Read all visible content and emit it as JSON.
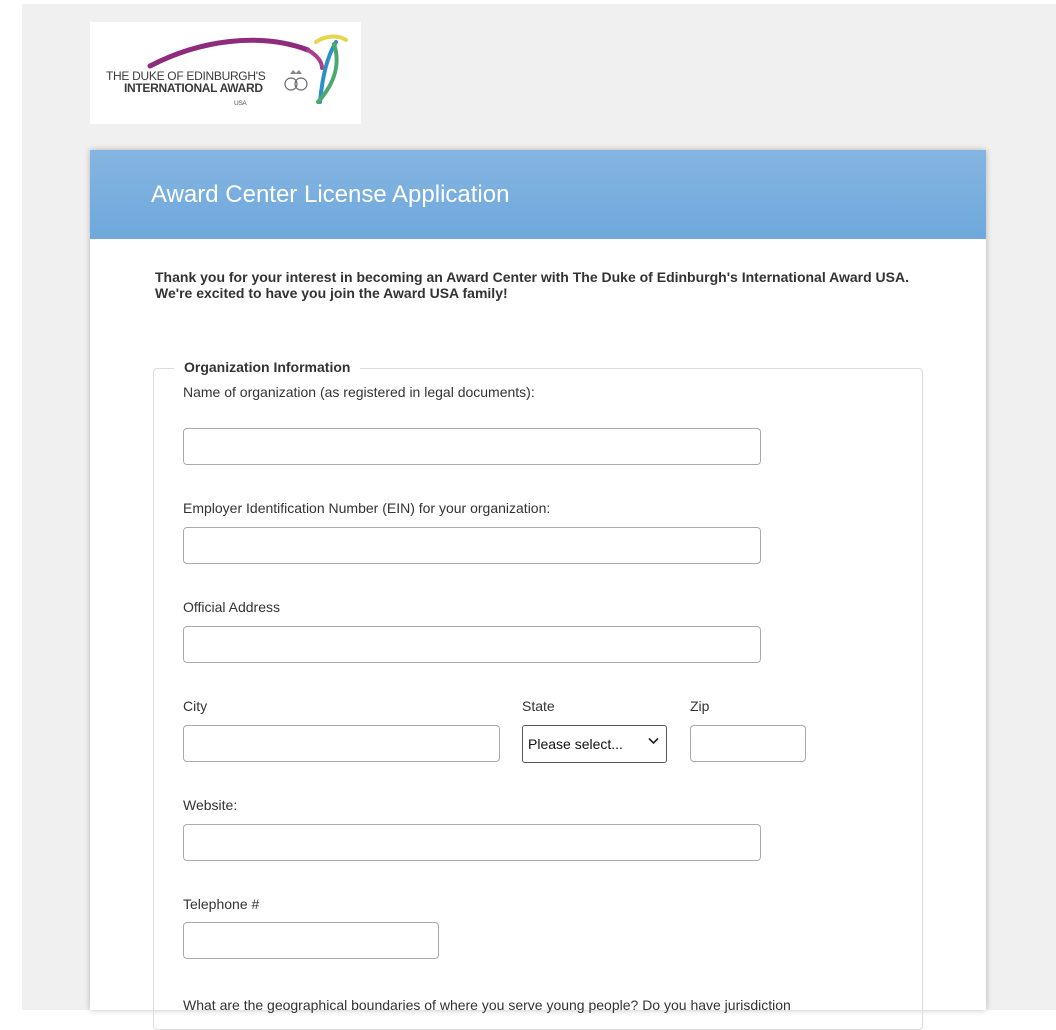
{
  "logo": {
    "line1": "THE DUKE OF EDINBURGH'S",
    "line2": "INTERNATIONAL AWARD",
    "line3": "USA",
    "colors": {
      "arc": "#8e2b7d",
      "bird_green": "#4aa96c",
      "bird_yellow": "#e8d548",
      "bird_blue": "#2d8fc7"
    }
  },
  "form": {
    "title": "Award Center License Application",
    "intro": "Thank you for your interest in becoming an Award Center with The Duke of Edinburgh's International Award USA. We're excited to have you join the Award USA family!",
    "section_legend": "Organization Information",
    "fields": {
      "org_name": {
        "label": "Name of organization (as registered in legal documents):",
        "value": ""
      },
      "ein": {
        "label": "Employer Identification Number (EIN) for your organization:",
        "value": ""
      },
      "address": {
        "label": "Official Address",
        "value": ""
      },
      "city": {
        "label": "City",
        "value": ""
      },
      "state": {
        "label": "State",
        "selected": "Please select..."
      },
      "zip": {
        "label": "Zip",
        "value": ""
      },
      "website": {
        "label": "Website:",
        "value": ""
      },
      "telephone": {
        "label": "Telephone #",
        "value": ""
      }
    },
    "question": "What are the geographical boundaries of where you serve young people? Do you have jurisdiction"
  },
  "colors": {
    "header": "#78ade0",
    "page_bg": "#f0f0f0"
  }
}
